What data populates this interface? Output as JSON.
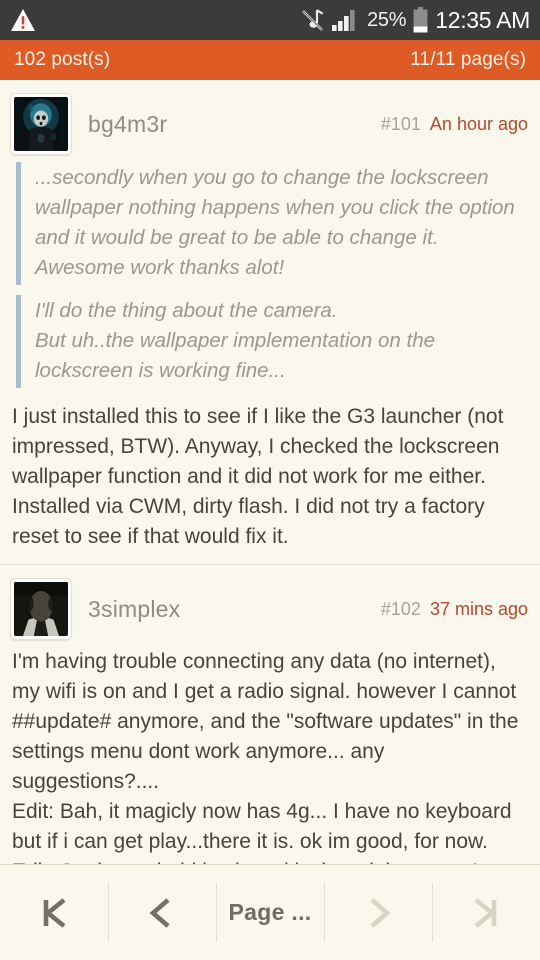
{
  "statusbar": {
    "warning_icon": "warning-triangle-icon",
    "mute_icon": "sound-muted-icon",
    "signal_icon": "cellular-signal-icon",
    "battery_percent": "25%",
    "battery_icon": "battery-icon",
    "clock": "12:35 AM",
    "bg_color": "#3b3b3b"
  },
  "header": {
    "post_count": "102 post(s)",
    "page_count": "11/11 page(s)",
    "bg_color": "#df5b25"
  },
  "posts": [
    {
      "avatar_name": "avatar-bg4m3r",
      "username": "bg4m3r",
      "number": "#101",
      "time": "An hour ago",
      "quotes": [
        "...secondly when you go to change the lockscreen wallpaper nothing happens when you click the option and it would be great to be able to change it. Awesome work thanks alot!",
        "I'll do the thing about the camera.\nBut uh..the wallpaper implementation on the lockscreen is working fine..."
      ],
      "body": "I just installed this to see if I like the G3 launcher (not impressed, BTW). Anyway, I checked the lockscreen wallpaper function and it did not work for me either. Installed via CWM, dirty flash. I did not try a factory reset to see if that would fix it."
    },
    {
      "avatar_name": "avatar-3simplex",
      "username": "3simplex",
      "number": "#102",
      "time": "37 mins ago",
      "quotes": [],
      "body": "I'm having trouble connecting any data (no internet), my wifi is on and I get a radio signal. however I cannot ##update# anymore, and the \"software updates\" in the settings menu dont work anymore... any suggestions?....\nEdit: Bah, it magicly now has 4g... I have no keyboard but if i can get play...there it is. ok im good, for now.\nEdit: So the android keyboard is there it just wasn't active, but who cares \"google keyboard\" is the shixx."
    }
  ],
  "pager": {
    "first_label": "first-page-icon",
    "prev_label": "previous-page-icon",
    "page_label": "Page ...",
    "next_label": "next-page-icon",
    "last_label": "last-page-icon",
    "enabled_color": "#6e6c64",
    "disabled_color": "#d9d3c3"
  },
  "colors": {
    "background": "#faf7ec",
    "accent_orange": "#df5b25",
    "time_red": "#b4482f",
    "quote_border": "#a9bccd"
  }
}
